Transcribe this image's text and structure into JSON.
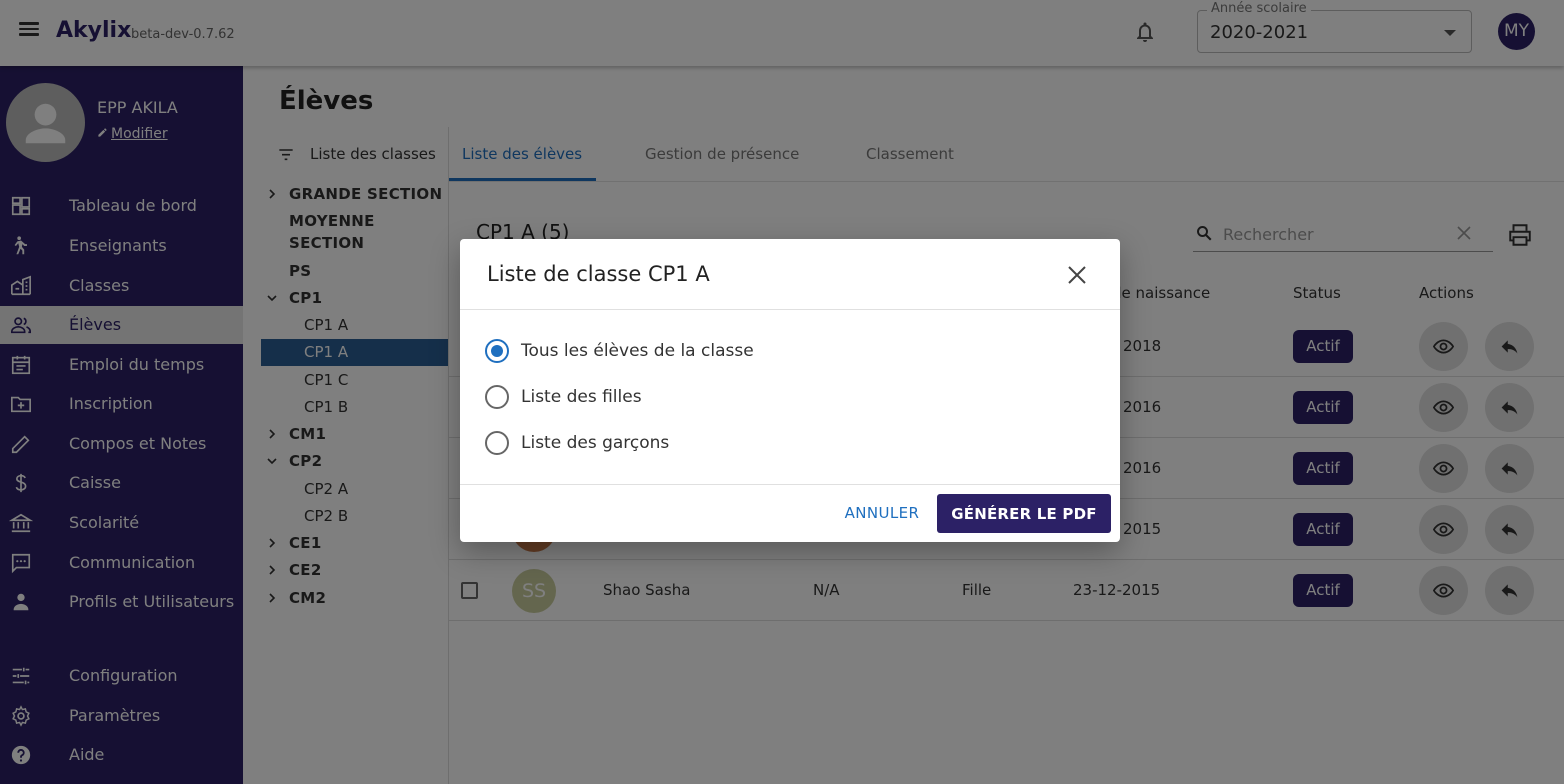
{
  "app": {
    "name": "Akylix",
    "version": "beta-dev-0.7.62"
  },
  "header": {
    "year_legend": "Année scolaire",
    "year_value": "2020-2021",
    "user_initials": "MY"
  },
  "sidebar": {
    "profile_name": "EPP AKILA",
    "edit_label": "Modifier",
    "items": [
      {
        "label": "Tableau de bord",
        "icon": "dashboard-icon"
      },
      {
        "label": "Enseignants",
        "icon": "teacher-icon"
      },
      {
        "label": "Classes",
        "icon": "classes-icon"
      },
      {
        "label": "Élèves",
        "icon": "students-icon"
      },
      {
        "label": "Emploi du temps",
        "icon": "calendar-icon"
      },
      {
        "label": "Inscription",
        "icon": "folder-add-icon"
      },
      {
        "label": "Compos et Notes",
        "icon": "pencil-icon"
      },
      {
        "label": "Caisse",
        "icon": "dollar-icon"
      },
      {
        "label": "Scolarité",
        "icon": "bank-icon"
      },
      {
        "label": "Communication",
        "icon": "chat-icon"
      },
      {
        "label": "Profils et Utilisateurs",
        "icon": "person-icon"
      },
      {
        "label": "Configuration",
        "icon": "sliders-icon"
      },
      {
        "label": "Paramètres",
        "icon": "gear-icon"
      },
      {
        "label": "Aide",
        "icon": "help-icon"
      }
    ]
  },
  "page": {
    "title": "Élèves"
  },
  "classes": {
    "header": "Liste des classes",
    "tree": [
      "GRANDE SECTION",
      "MOYENNE",
      "SECTION",
      "PS",
      "CP1",
      "CP1 A",
      "CP1 A",
      "CP1 C",
      "CP1 B",
      "CM1",
      "CP2",
      "CP2 A",
      "CP2 B",
      "CE1",
      "CE2",
      "CM2"
    ]
  },
  "tabs": [
    "Liste des élèves",
    "Gestion de présence",
    "Classement"
  ],
  "table": {
    "title": "CP1 A (5)",
    "search_placeholder": "Rechercher",
    "columns": {
      "birth": "de naissance",
      "status": "Status",
      "actions": "Actions"
    },
    "rows": [
      {
        "initials": "",
        "name": "",
        "matricule": "",
        "gender": "",
        "birth": "2018",
        "status": "Actif"
      },
      {
        "initials": "",
        "name": "",
        "matricule": "",
        "gender": "",
        "birth": "2016",
        "status": "Actif"
      },
      {
        "initials": "",
        "name": "",
        "matricule": "",
        "gender": "",
        "birth": "2016",
        "status": "Actif"
      },
      {
        "initials": "",
        "name": "",
        "matricule": "",
        "gender": "",
        "birth": "2015",
        "status": "Actif"
      },
      {
        "initials": "SS",
        "name": "Shao Sasha",
        "matricule": "N/A",
        "gender": "Fille",
        "birth": "23-12-2015",
        "status": "Actif"
      }
    ]
  },
  "modal": {
    "title": "Liste de classe CP1 A",
    "options": [
      "Tous les élèves de la classe",
      "Liste des filles",
      "Liste des garçons"
    ],
    "selected_index": 0,
    "cancel_label": "ANNULER",
    "generate_label": "GÉNÉRER LE PDF"
  },
  "colors": {
    "primary": "#2c2166",
    "accent": "#1f6fbf",
    "selected_tree": "#2b5f95"
  }
}
